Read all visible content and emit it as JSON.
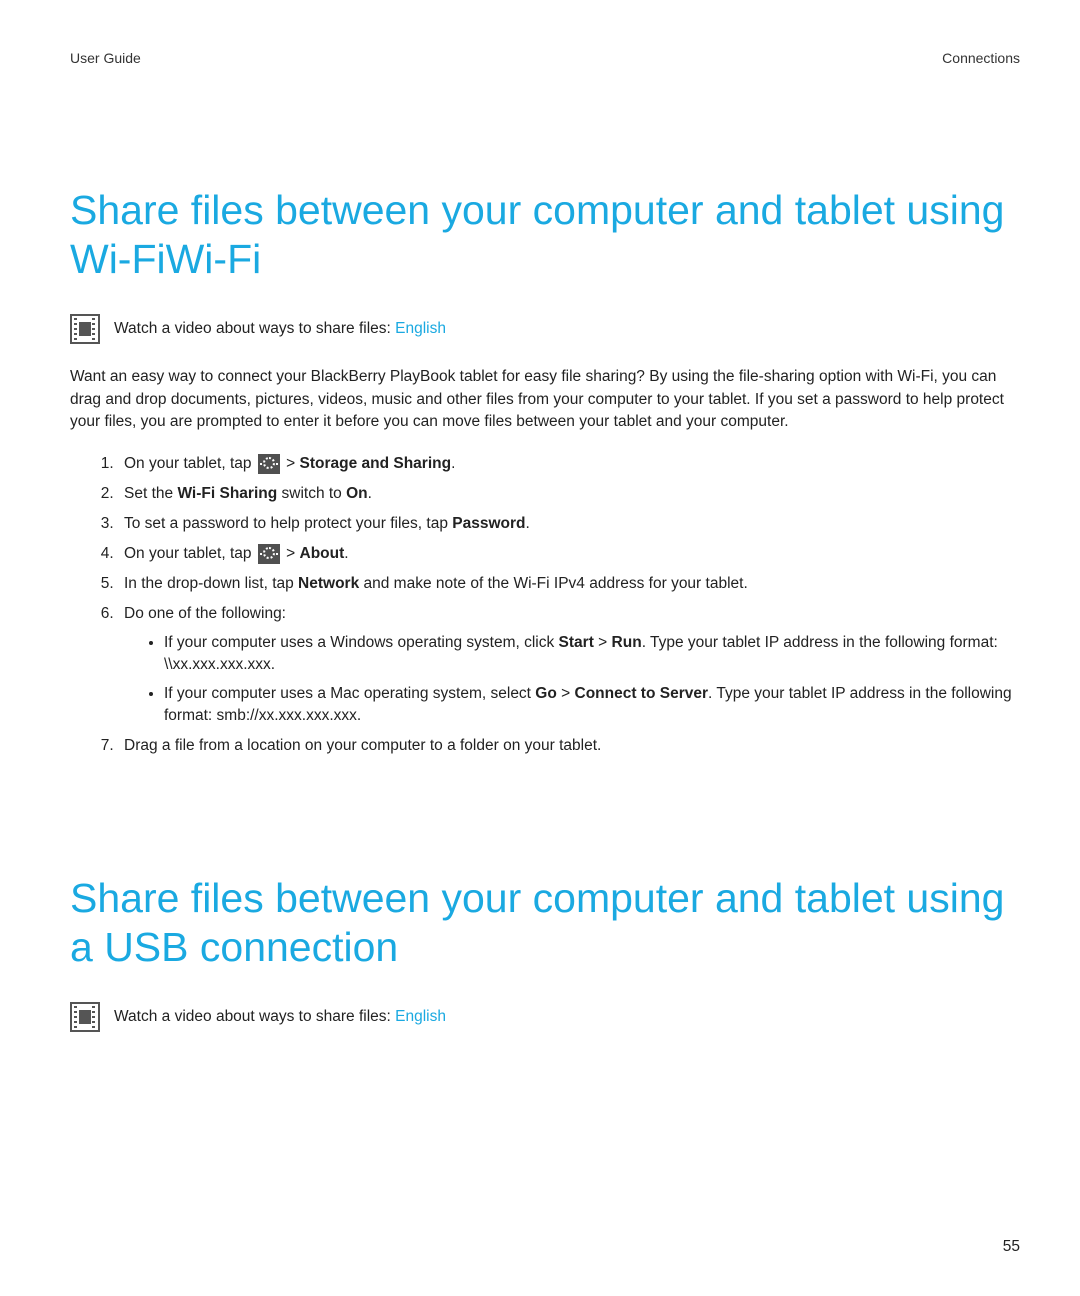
{
  "header": {
    "left": "User Guide",
    "right": "Connections"
  },
  "section1": {
    "title": "Share files between your computer and tablet using Wi-FiWi-Fi",
    "video_caption_prefix": "Watch a video about ways to share files: ",
    "video_link": "English",
    "intro": "Want an easy way to connect your BlackBerry PlayBook tablet for easy file sharing? By using the file-sharing option with Wi-Fi, you can drag and drop documents, pictures, videos, music and other files from your computer to your tablet. If you set a password to help protect your files, you are prompted to enter it before you can move files between your tablet and your computer.",
    "steps": {
      "s1_a": "On your tablet, tap ",
      "s1_b": " > ",
      "s1_c": "Storage and Sharing",
      "s1_d": ".",
      "s2_a": "Set the ",
      "s2_b": "Wi-Fi Sharing",
      "s2_c": " switch to ",
      "s2_d": "On",
      "s2_e": ".",
      "s3_a": "To set a password to help protect your files, tap ",
      "s3_b": "Password",
      "s3_c": ".",
      "s4_a": "On your tablet, tap ",
      "s4_b": " > ",
      "s4_c": "About",
      "s4_d": ".",
      "s5_a": "In the drop-down list, tap ",
      "s5_b": "Network",
      "s5_c": " and make note of the Wi-Fi IPv4 address for your tablet.",
      "s6": "Do one of the following:",
      "s6_sub1_a": "If your computer uses a Windows operating system, click ",
      "s6_sub1_b": "Start",
      "s6_sub1_c": " > ",
      "s6_sub1_d": "Run",
      "s6_sub1_e": ". Type your tablet IP address in the following format: \\\\xx.xxx.xxx.xxx.",
      "s6_sub2_a": "If your computer uses a Mac operating system, select ",
      "s6_sub2_b": "Go",
      "s6_sub2_c": " > ",
      "s6_sub2_d": "Connect to Server",
      "s6_sub2_e": ". Type your tablet IP address in the following format: smb://xx.xxx.xxx.xxx.",
      "s7": "Drag a file from a location on your computer to a folder on your tablet."
    }
  },
  "section2": {
    "title": "Share files between your computer and tablet using a USB connection",
    "video_caption_prefix": "Watch a video about ways to share files: ",
    "video_link": "English"
  },
  "page_number": "55"
}
